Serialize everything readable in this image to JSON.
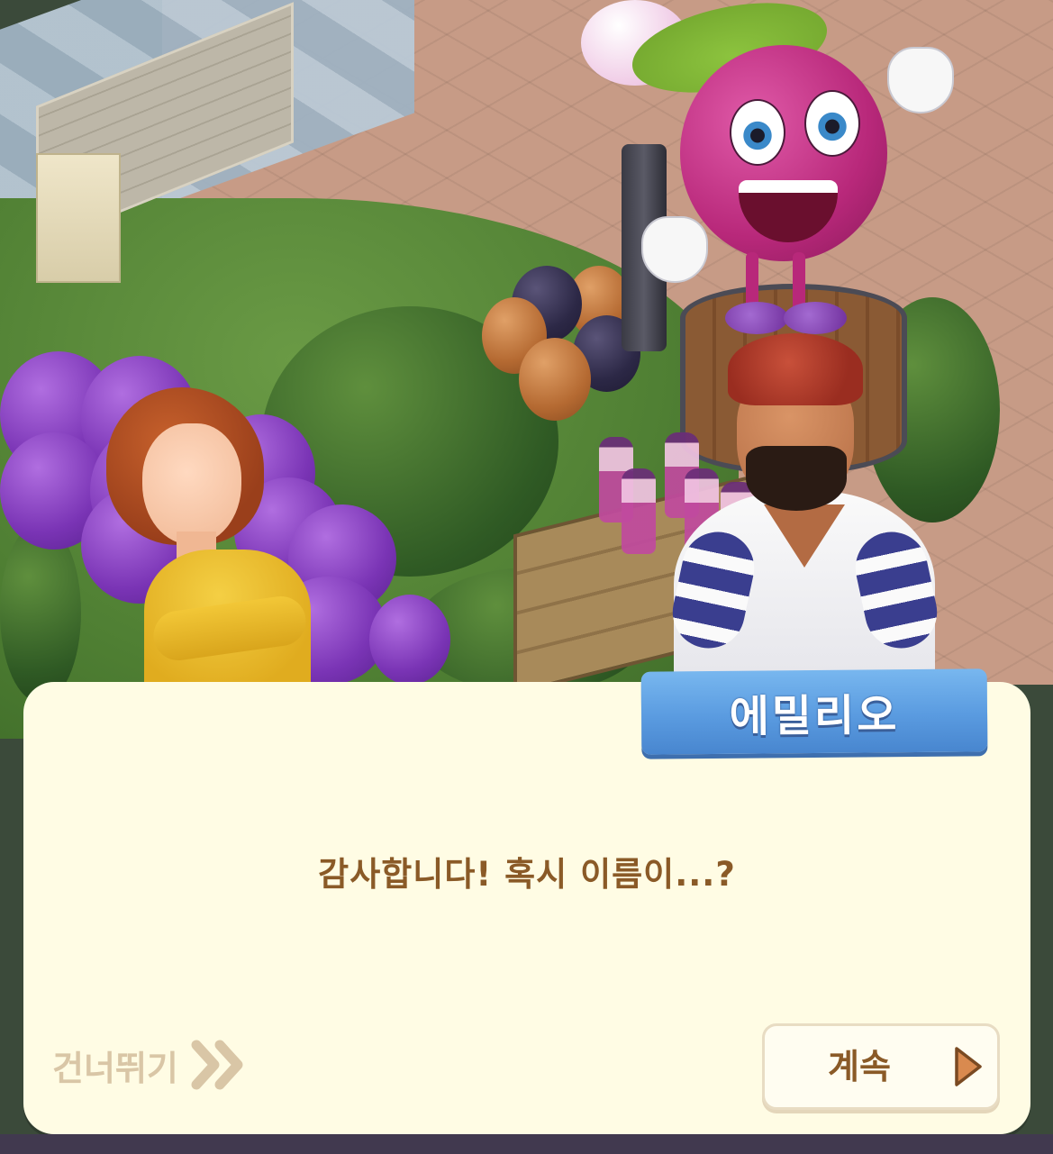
{
  "dialog": {
    "speaker_name": "에밀리오",
    "message": "감사합니다! 혹시 이름이...?"
  },
  "controls": {
    "skip_label": "건너뛰기",
    "skip_icon": "double-chevron-right-icon",
    "continue_label": "계속",
    "continue_icon": "play-triangle-icon"
  },
  "colors": {
    "dialog_background": "#fffce4",
    "name_tag_blue": "#5a9be0",
    "dialog_text": "#8a5a27",
    "skip_text": "#d9c6a6",
    "continue_arrow": "#d98a4f"
  }
}
